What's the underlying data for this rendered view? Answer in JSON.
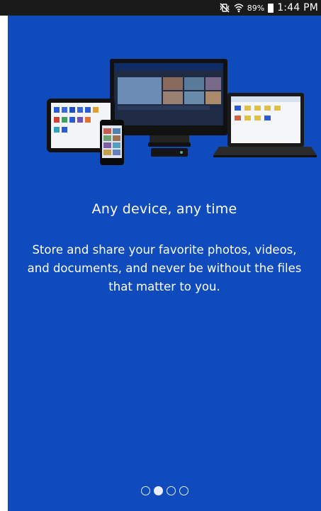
{
  "status_bar": {
    "mute_icon": "vibrate-mute-icon",
    "wifi_icon": "wifi-icon",
    "battery_percent": "89%",
    "battery_icon": "battery-icon",
    "time": "1:44 PM"
  },
  "onboarding": {
    "title": "Any device, any time",
    "description": "Store and share your favorite photos, videos, and documents, and never be without the files that matter to you.",
    "pager": {
      "total_pages": 4,
      "current_page": 2
    }
  },
  "colors": {
    "background": "#0f4bbd",
    "status_bar": "#1a1a1a",
    "text": "#ffffff"
  }
}
